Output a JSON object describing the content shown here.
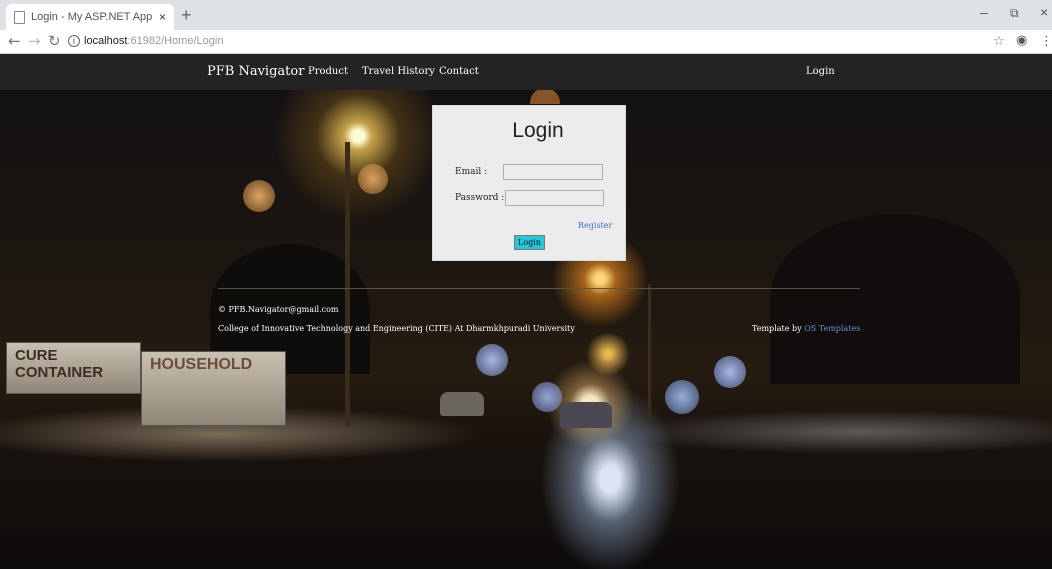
{
  "browser": {
    "tab_title": "Login - My ASP.NET Application",
    "tab_close": "×",
    "new_tab": "+",
    "url_host": "localhost",
    "url_path": ":61982/Home/Login",
    "back": "←",
    "forward": "→",
    "reload": "↻",
    "info": "i",
    "bookmark": "☆",
    "profile": "◉",
    "menu": "⋮",
    "minimize": "–",
    "maximize": "⧉",
    "close": "×"
  },
  "nav": {
    "brand": "PFB Navigator",
    "links": [
      "Product",
      "Travel History",
      "Contact"
    ],
    "login": "Login"
  },
  "login": {
    "title": "Login",
    "email_label": "Email :",
    "email_value": "",
    "password_label": "Password :",
    "password_value": "",
    "register": "Register",
    "submit": "Login"
  },
  "background": {
    "signs": [
      "CURE CONTAINER",
      "HOUSEHOLD"
    ]
  },
  "footer": {
    "email": "© PFB.Navigator@gmail.com",
    "college": "College of Innovative Technology and Engineering (CITE) At Dharmkhpuradi University",
    "template_prefix": "Template by ",
    "template_link": "OS Templates"
  },
  "colors": {
    "navbar": "#232323",
    "card": "#ececec",
    "button": "#27c6d8",
    "link": "#3b6fc1"
  }
}
